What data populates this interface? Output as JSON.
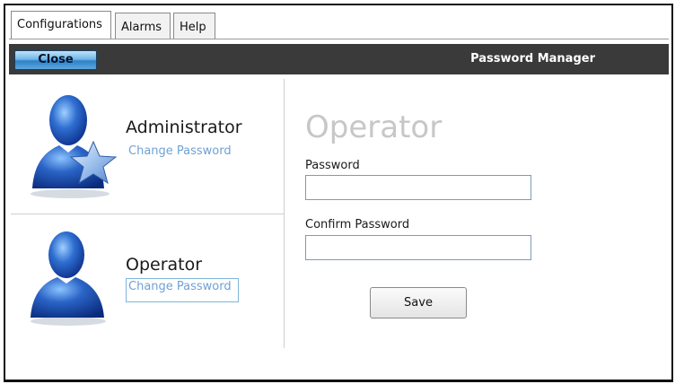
{
  "tabs": [
    {
      "label": "Configurations",
      "active": true
    },
    {
      "label": "Alarms",
      "active": false
    },
    {
      "label": "Help",
      "active": false
    }
  ],
  "header": {
    "close_label": "Close",
    "title": "Password Manager"
  },
  "roles": [
    {
      "name": "Administrator",
      "link": "Change Password",
      "icon": "admin-star-user-icon"
    },
    {
      "name": "Operator",
      "link": "Change Password",
      "icon": "user-icon"
    }
  ],
  "form": {
    "title": "Operator",
    "password_label": "Password",
    "password_value": "",
    "confirm_label": "Confirm Password",
    "confirm_value": "",
    "save_label": "Save"
  },
  "colors": {
    "header_bar": "#3a3a3a",
    "link": "#6fa1d6",
    "close_button": "#3d8fd3",
    "form_title": "#c7c7c7"
  }
}
